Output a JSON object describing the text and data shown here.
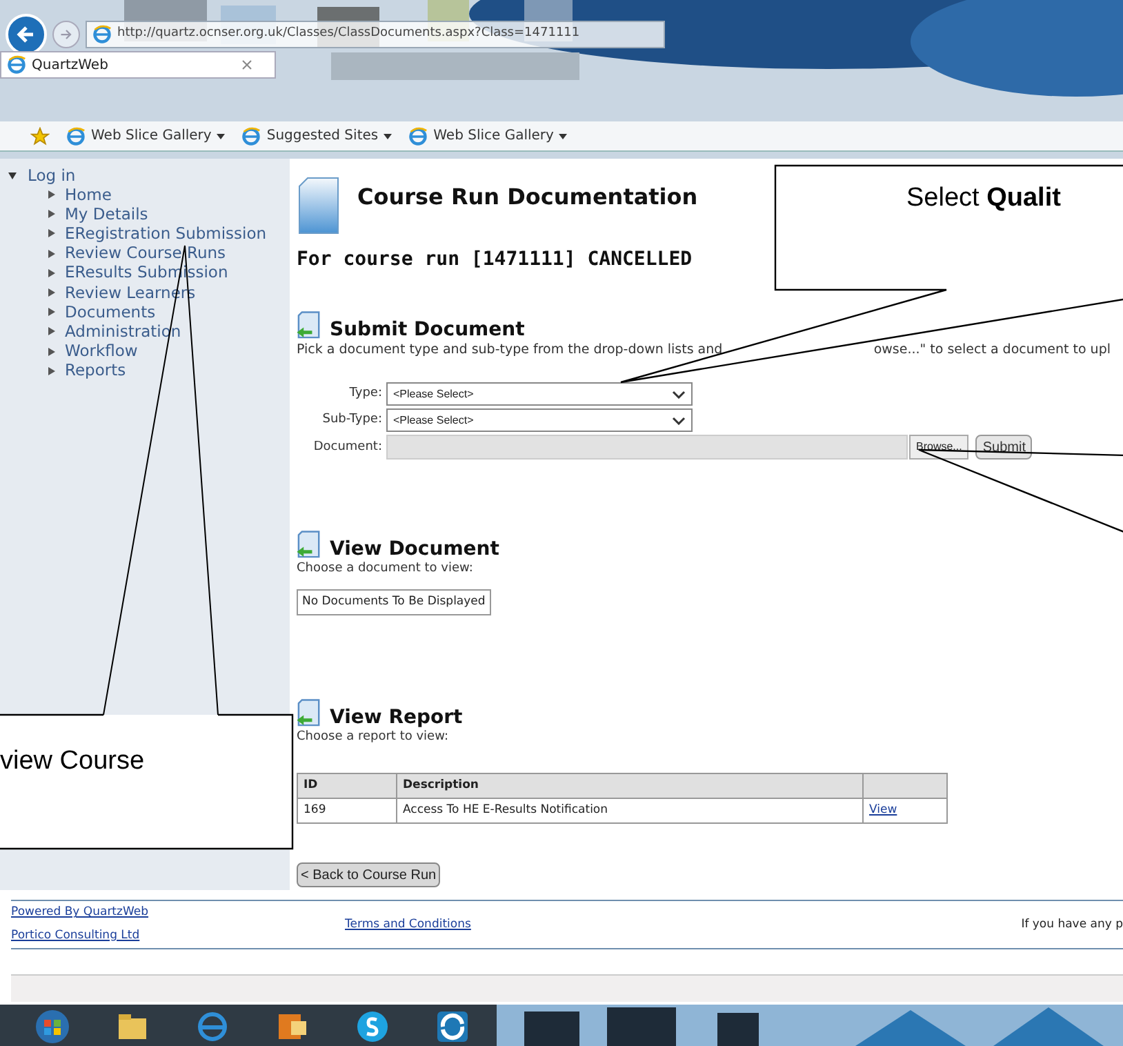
{
  "browser": {
    "url": "http://quartz.ocnser.org.uk/Classes/ClassDocuments.aspx?Class=1471111",
    "tab_title": "QuartzWeb",
    "favorites": [
      {
        "label": "Web Slice Gallery",
        "has_menu": true
      },
      {
        "label": "Suggested Sites",
        "has_menu": true
      },
      {
        "label": "Web Slice Gallery",
        "has_menu": true
      }
    ]
  },
  "sidebar": {
    "root": {
      "label": "Log in",
      "expanded": true,
      "children": [
        {
          "label": "Home"
        },
        {
          "label": "My Details"
        },
        {
          "label": "ERegistration Submission"
        },
        {
          "label": "Review Course Runs"
        },
        {
          "label": "EResults Submission"
        },
        {
          "label": "Review Learners"
        },
        {
          "label": "Documents"
        },
        {
          "label": "Administration"
        },
        {
          "label": "Workflow"
        },
        {
          "label": "Reports"
        }
      ]
    }
  },
  "page": {
    "title": "Course Run Documentation",
    "subtitle": "For course run [1471111] CANCELLED",
    "submit": {
      "heading": "Submit Document",
      "intro_start": "Pick a document type and sub-type from the drop-down lists and",
      "intro_end": "owse...\" to select a document to upl",
      "fields": [
        {
          "kind": "select",
          "label": "Type:",
          "value": "<Please Select>"
        },
        {
          "kind": "select",
          "label": "Sub-Type:",
          "value": "<Please Select>"
        },
        {
          "kind": "file",
          "label": "Document:",
          "browse": "Browse...",
          "submit": "Submit"
        }
      ]
    },
    "view_document": {
      "heading": "View Document",
      "intro": "Choose a document to view:",
      "empty": "No Documents To Be Displayed"
    },
    "view_report": {
      "heading": "View Report",
      "intro": "Choose a report to view:",
      "columns": [
        "ID",
        "Description",
        ""
      ],
      "rows": [
        {
          "id": "169",
          "description": "Access To HE E-Results Notification",
          "link": "View"
        }
      ]
    },
    "back_button": "< Back to Course Run"
  },
  "footer": {
    "left_links": [
      "Powered By QuartzWeb",
      "Portico Consulting Ltd"
    ],
    "center_link": "Terms and Conditions",
    "right_text": "If you have any p"
  },
  "callouts": [
    {
      "text": "Select **Qualit**"
    },
    {
      "text": "view Course"
    }
  ]
}
